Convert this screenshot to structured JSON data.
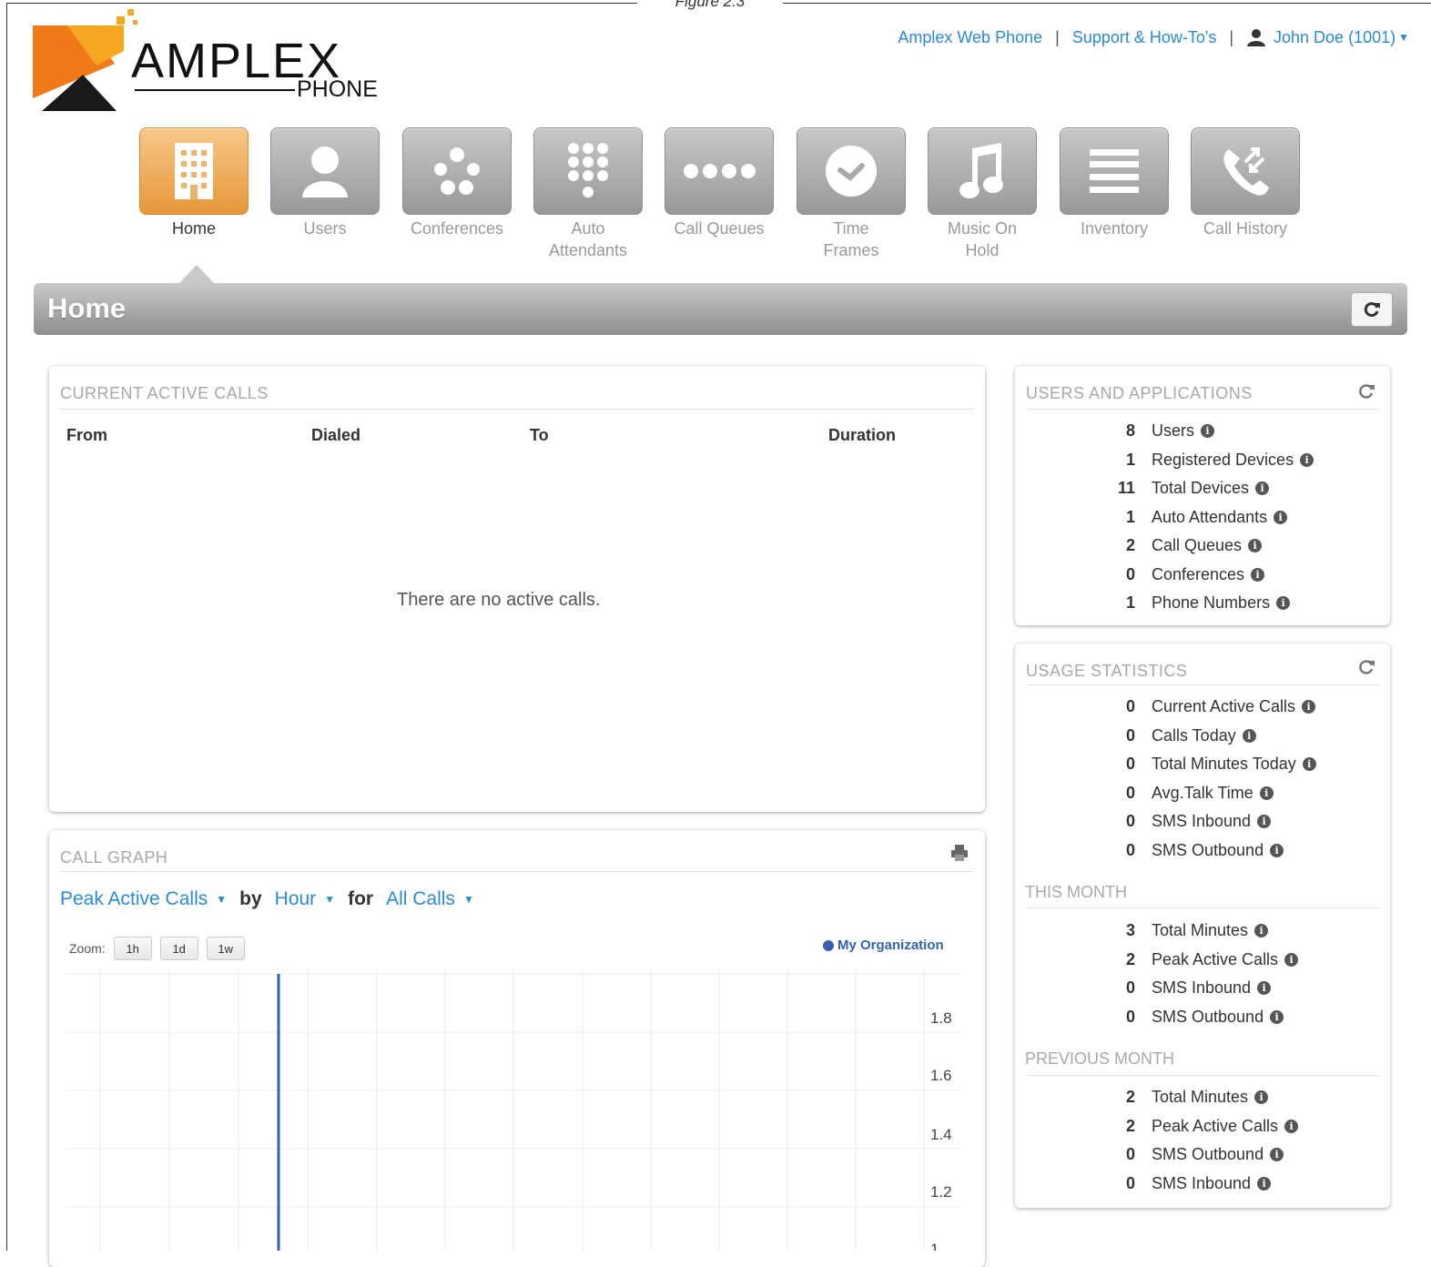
{
  "figure_caption": "Figure 2.3",
  "logo": {
    "brand": "AMPLEX",
    "sub": "PHONE"
  },
  "top_links": {
    "web_phone": "Amplex Web Phone",
    "support": "Support & How-To's",
    "user": "John Doe (1001)"
  },
  "nav": [
    {
      "label": "Home",
      "icon": "building-icon",
      "active": true
    },
    {
      "label": "Users",
      "icon": "user-icon"
    },
    {
      "label": "Conferences",
      "icon": "conference-icon"
    },
    {
      "label": "Auto\nAttendants",
      "icon": "keypad-icon"
    },
    {
      "label": "Call Queues",
      "icon": "queue-icon"
    },
    {
      "label": "Time\nFrames",
      "icon": "clock-icon"
    },
    {
      "label": "Music On\nHold",
      "icon": "music-note-icon"
    },
    {
      "label": "Inventory",
      "icon": "list-icon"
    },
    {
      "label": "Call History",
      "icon": "phone-arrows-icon"
    }
  ],
  "header": {
    "title": "Home"
  },
  "active_calls": {
    "title": "CURRENT ACTIVE CALLS",
    "columns": [
      "From",
      "Dialed",
      "To",
      "Duration"
    ],
    "empty_message": "There are no active calls."
  },
  "users_apps": {
    "title": "USERS AND APPLICATIONS",
    "rows": [
      {
        "value": "8",
        "label": "Users"
      },
      {
        "value": "1",
        "label": "Registered Devices"
      },
      {
        "value": "11",
        "label": "Total Devices"
      },
      {
        "value": "1",
        "label": "Auto Attendants"
      },
      {
        "value": "2",
        "label": "Call Queues"
      },
      {
        "value": "0",
        "label": "Conferences"
      },
      {
        "value": "1",
        "label": "Phone Numbers"
      }
    ]
  },
  "usage": {
    "title": "USAGE STATISTICS",
    "rows": [
      {
        "value": "0",
        "label": "Current Active Calls"
      },
      {
        "value": "0",
        "label": "Calls Today"
      },
      {
        "value": "0",
        "label": "Total Minutes Today"
      },
      {
        "value": "0",
        "label": "Avg.Talk Time"
      },
      {
        "value": "0",
        "label": "SMS Inbound"
      },
      {
        "value": "0",
        "label": "SMS Outbound"
      }
    ],
    "this_month_title": "THIS MONTH",
    "this_month": [
      {
        "value": "3",
        "label": "Total Minutes"
      },
      {
        "value": "2",
        "label": "Peak Active Calls"
      },
      {
        "value": "0",
        "label": "SMS Inbound"
      },
      {
        "value": "0",
        "label": "SMS Outbound"
      }
    ],
    "prev_month_title": "PREVIOUS MONTH",
    "prev_month": [
      {
        "value": "2",
        "label": "Total Minutes"
      },
      {
        "value": "2",
        "label": "Peak Active Calls"
      },
      {
        "value": "0",
        "label": "SMS Outbound"
      },
      {
        "value": "0",
        "label": "SMS Inbound"
      }
    ]
  },
  "call_graph": {
    "title": "CALL GRAPH",
    "metric": "Peak Active Calls",
    "by_word": "by",
    "period": "Hour",
    "for_word": "for",
    "scope": "All Calls",
    "zoom_label": "Zoom:",
    "zoom_buttons": [
      "1h",
      "1d",
      "1w"
    ],
    "legend": "My Organization"
  },
  "chart_data": {
    "type": "line",
    "y_ticks": [
      "1.8",
      "1.6",
      "1.4",
      "1.2",
      "1"
    ],
    "series": [
      {
        "name": "My Organization",
        "color": "#3a5fb0"
      }
    ]
  }
}
